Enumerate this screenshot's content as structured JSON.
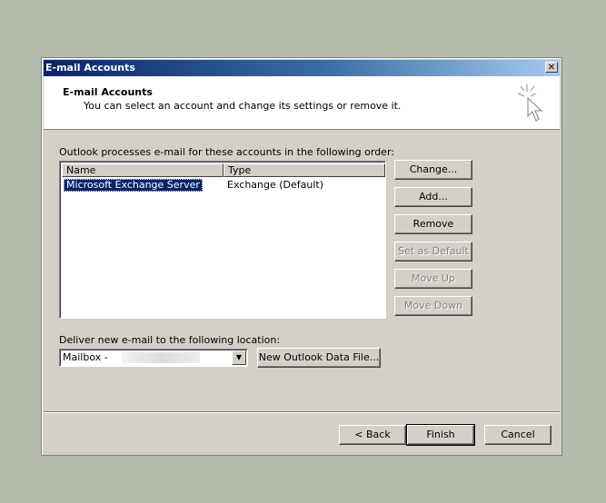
{
  "window": {
    "title": "E-mail Accounts",
    "close_glyph": "✕"
  },
  "header": {
    "title": "E-mail Accounts",
    "subtitle": "You can select an account and change its settings or remove it."
  },
  "accounts": {
    "intro_label": "Outlook processes e-mail for these accounts in the following order:",
    "columns": [
      "Name",
      "Type"
    ],
    "rows": [
      {
        "name": "Microsoft Exchange Server",
        "type": "Exchange (Default)"
      }
    ]
  },
  "side_buttons": {
    "change": "Change...",
    "add": "Add...",
    "remove": "Remove",
    "set_default": "Set as Default",
    "move_up": "Move Up",
    "move_down": "Move Down"
  },
  "deliver": {
    "label": "Deliver new e-mail to the following location:",
    "selected_value": "Mailbox -",
    "new_data_file": "New Outlook Data File..."
  },
  "footer": {
    "back": "< Back",
    "finish": "Finish",
    "cancel": "Cancel"
  },
  "icons": {
    "wizard": "wizard-cursor-icon",
    "dropdown": "chevron-down-icon"
  }
}
